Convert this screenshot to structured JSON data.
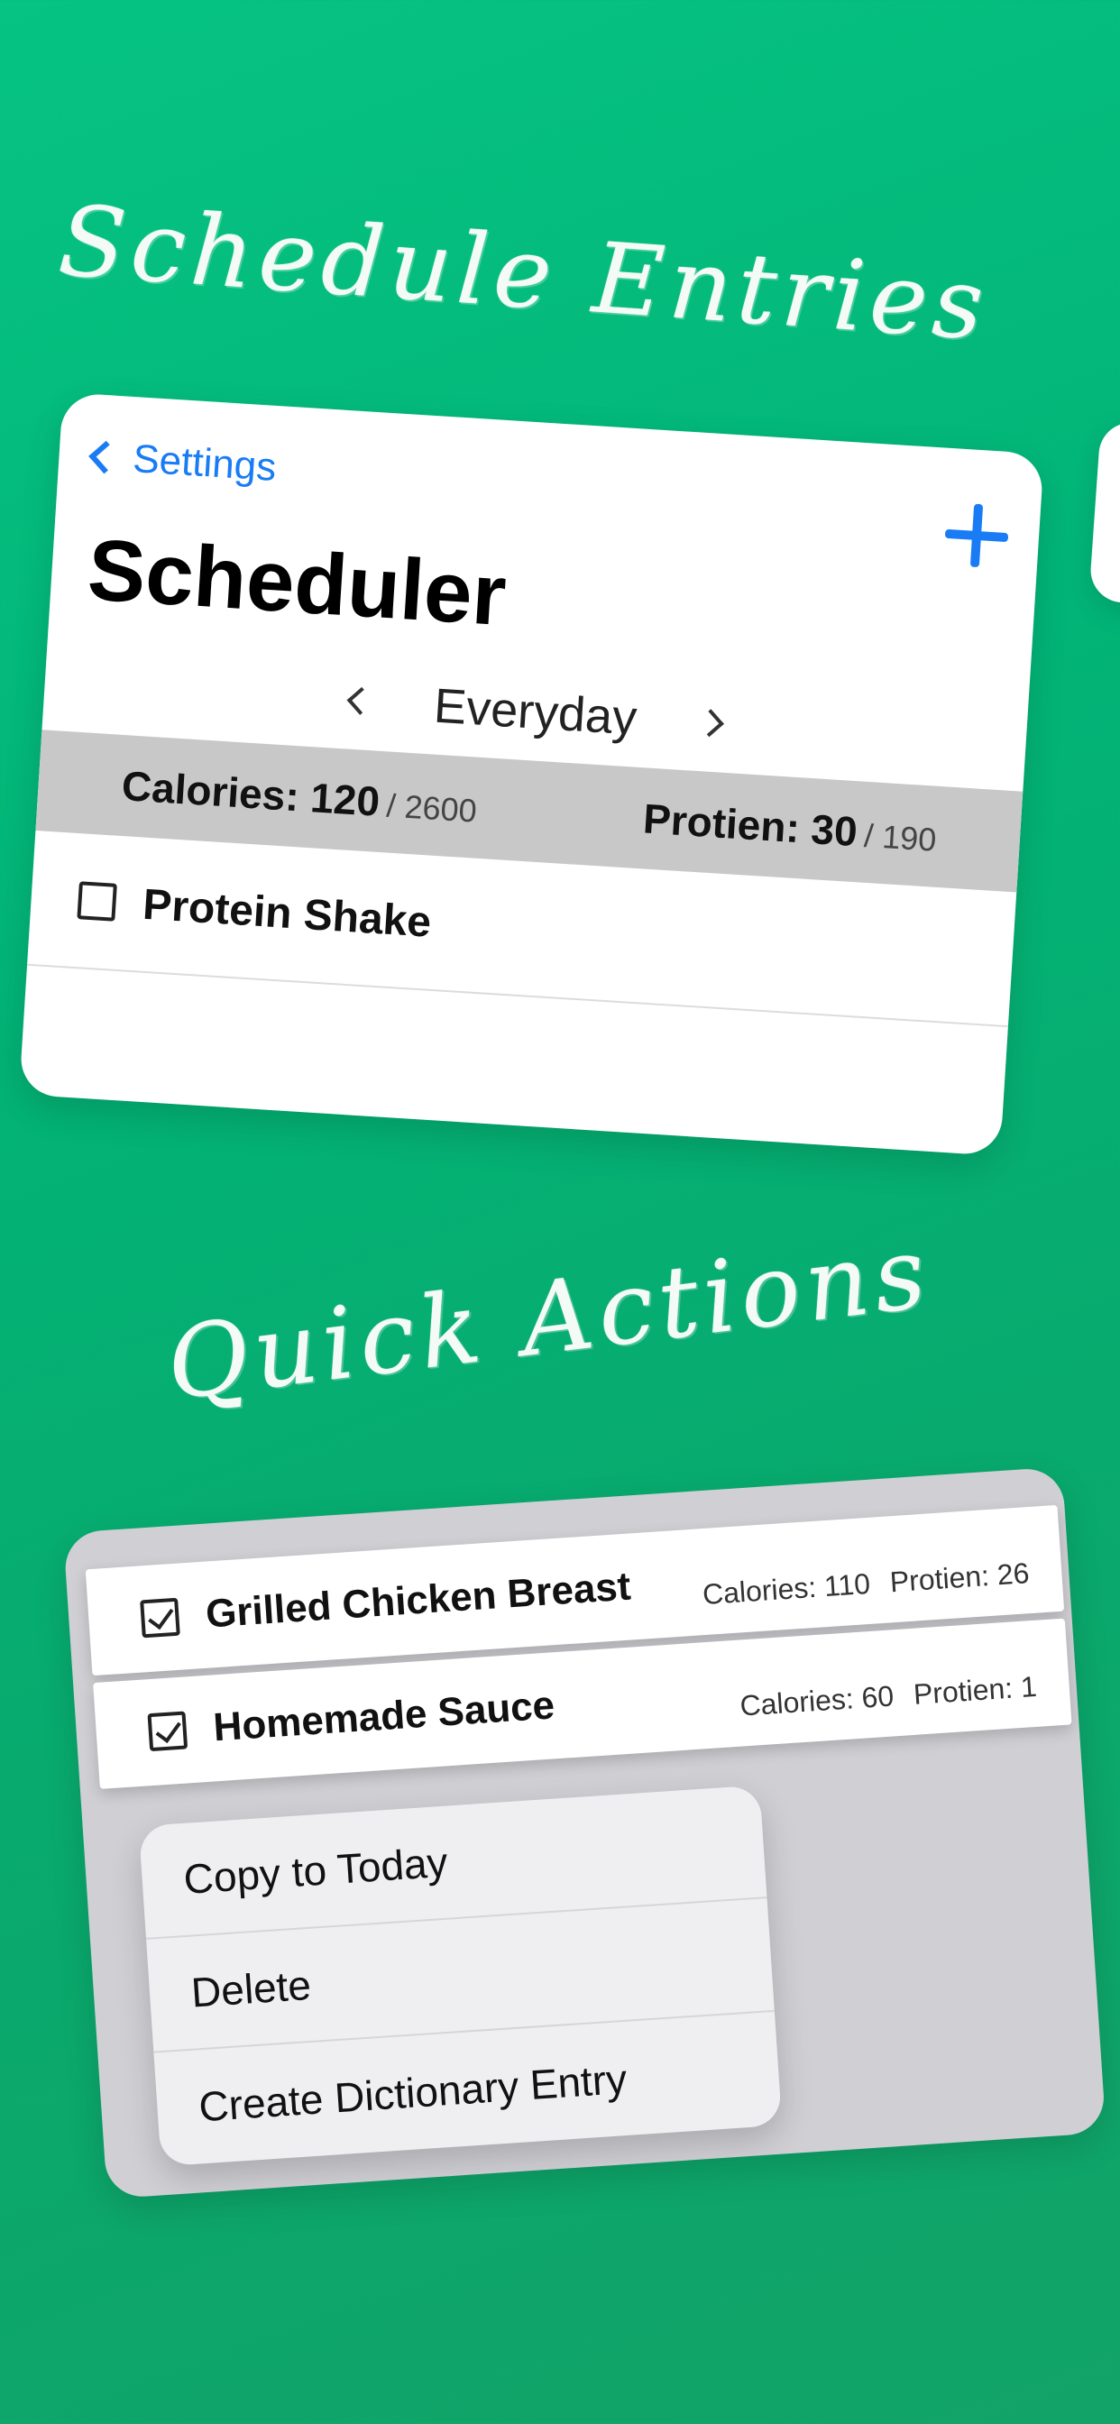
{
  "headings": {
    "schedule": "Schedule Entries",
    "quick_actions": "Quick Actions"
  },
  "scheduler": {
    "back_label": "Settings",
    "title": "Scheduler",
    "day": "Everyday",
    "calories_label": "Calories: 120",
    "calories_goal": "/ 2600",
    "protein_label": "Protien: 30",
    "protein_goal": "/ 190",
    "entries": [
      {
        "name": "Protein Shake",
        "checked": false
      }
    ],
    "accent": "#1a7cf5",
    "icons": [
      "chevron-left-icon",
      "plus-icon",
      "chevron-right-icon",
      "checkbox-icon"
    ]
  },
  "quick": {
    "entries": [
      {
        "name": "Grilled Chicken Breast",
        "calories": "Calories: 110",
        "protein": "Protien: 26",
        "checked": true
      },
      {
        "name": "Homemade Sauce",
        "calories": "Calories: 60",
        "protein": "Protien: 1",
        "checked": true
      }
    ],
    "menu": [
      "Copy to Today",
      "Delete",
      "Create Dictionary Entry"
    ]
  },
  "colors": {
    "background": "#02b477",
    "heading": "#f4fbf6",
    "summary_bar": "#c8c8c8"
  }
}
